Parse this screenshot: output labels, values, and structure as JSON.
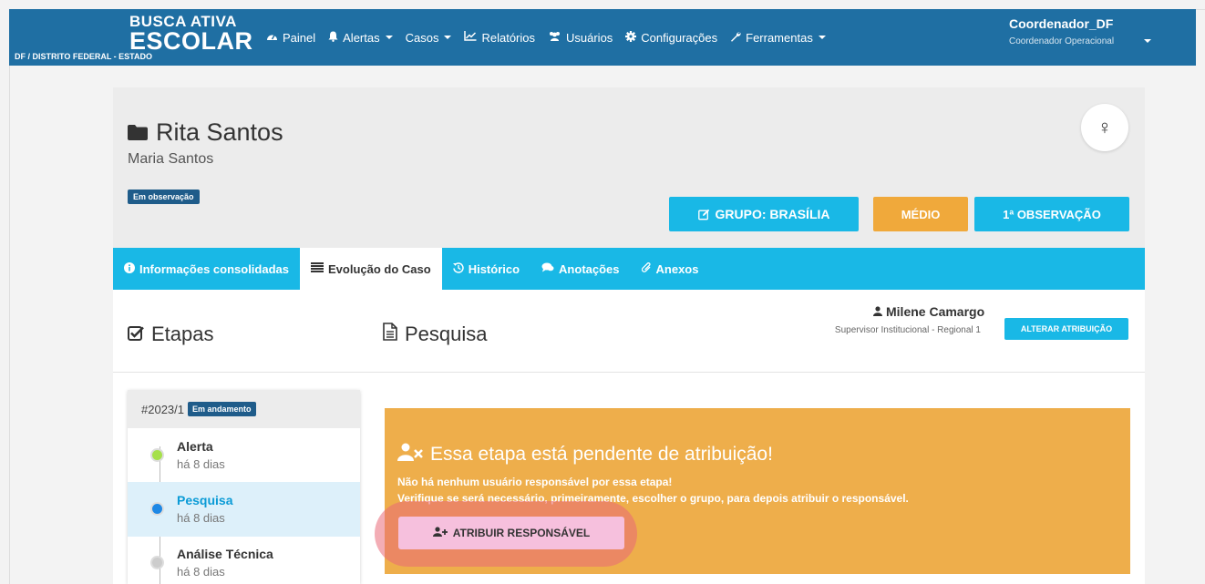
{
  "brand": {
    "line1": "BUSCA ATIVA",
    "line2": "ESCOLAR",
    "line3": "DF / DISTRITO FEDERAL - ESTADO"
  },
  "nav": {
    "items": [
      {
        "label": "Painel",
        "icon": "dashboard-icon"
      },
      {
        "label": "Alertas",
        "icon": "bell-icon"
      },
      {
        "label": "Casos",
        "icon": ""
      },
      {
        "label": "Relatórios",
        "icon": "line-chart-icon"
      },
      {
        "label": "Usuários",
        "icon": "users-icon"
      },
      {
        "label": "Configurações",
        "icon": "gear-icon"
      },
      {
        "label": "Ferramentas",
        "icon": "wrench-icon"
      }
    ]
  },
  "user": {
    "name": "Coordenador_DF",
    "role": "Coordenador Operacional"
  },
  "case": {
    "title": "Rita Santos",
    "subtitle": "Maria Santos",
    "status_badge": "Em observação",
    "group_button": "GRUPO: BRASÍLIA",
    "risk_button": "MÉDIO",
    "observation_button": "1ª OBSERVAÇÃO",
    "gender_symbol": "♀"
  },
  "tabs": [
    {
      "label": "Informações consolidadas",
      "icon": "info-icon"
    },
    {
      "label": "Evolução do Caso",
      "icon": "list-icon"
    },
    {
      "label": "Histórico",
      "icon": "history-icon"
    },
    {
      "label": "Anotações",
      "icon": "comments-icon"
    },
    {
      "label": "Anexos",
      "icon": "paperclip-icon"
    }
  ],
  "content": {
    "steps_title": "Etapas",
    "stage_title": "Pesquisa",
    "assignee_name": "Milene Camargo",
    "assignee_role": "Supervisor Institucional - Regional 1",
    "change_button": "ALTERAR ATRIBUIÇÃO"
  },
  "steps_card": {
    "case_id": "#2023/1",
    "status": "Em andamento",
    "steps": [
      {
        "name": "Alerta",
        "when": "há 8 dias",
        "dot_color": "#a6e04a"
      },
      {
        "name": "Pesquisa",
        "when": "há 8 dias",
        "dot_color": "#1e88e5"
      },
      {
        "name": "Análise Técnica",
        "when": "há 8 dias",
        "dot_color": "#cccccc"
      }
    ]
  },
  "alert": {
    "title": "Essa etapa está pendente de atribuição!",
    "line1": "Não há nenhum usuário responsável por essa etapa!",
    "line2": "Verifique se será necessário, primeiramente, escolher o grupo, para depois atribuir o responsável.",
    "button": "ATRIBUIR RESPONSÁVEL"
  },
  "colors": {
    "navbar": "#1f6fa3",
    "accent": "#19b8e6",
    "warning": "#eeae4b",
    "badge": "#1f5c8a"
  }
}
